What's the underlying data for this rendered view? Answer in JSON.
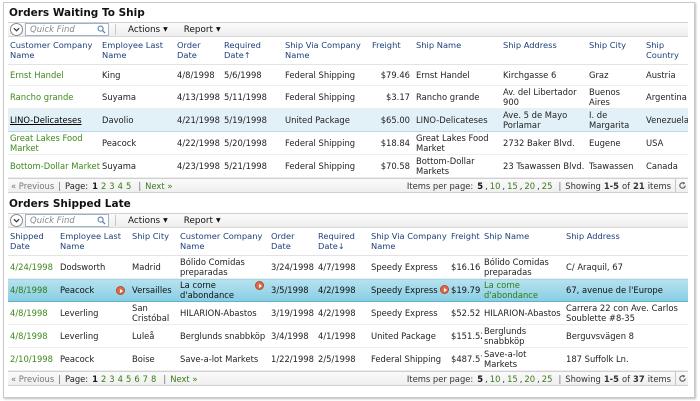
{
  "grid1": {
    "title": "Orders Waiting To Ship",
    "quick_find_placeholder": "Quick Find",
    "actions_label": "Actions",
    "report_label": "Report",
    "columns": [
      "Customer Company Name",
      "Employee Last Name",
      "Order Date",
      "Required Date",
      "Ship Via Company Name",
      "Freight",
      "Ship Name",
      "Ship Address",
      "Ship City",
      "Ship Country"
    ],
    "sort_arrow": "↑",
    "rows": [
      {
        "company": "Ernst Handel",
        "employee": "King",
        "order_date": "4/8/1998",
        "required_date": "5/6/1998",
        "ship_via": "Federal Shipping",
        "freight": "$79.46",
        "ship_name": "Ernst Handel",
        "address": "Kirchgasse 6",
        "city": "Graz",
        "country": "Austria"
      },
      {
        "company": "Rancho grande",
        "employee": "Suyama",
        "order_date": "4/13/1998",
        "required_date": "5/11/1998",
        "ship_via": "Federal Shipping",
        "freight": "$3.17",
        "ship_name": "Rancho grande",
        "address": "Av. del Libertador 900",
        "city": "Buenos Aires",
        "country": "Argentina"
      },
      {
        "company": "LINO-Delicateses",
        "employee": "Davolio",
        "order_date": "4/21/1998",
        "required_date": "5/19/1998",
        "ship_via": "United Package",
        "freight": "$65.00",
        "ship_name": "LINO-Delicateses",
        "address": "Ave. 5 de Mayo Porlamar",
        "city": "I. de Margarita",
        "country": "Venezuela"
      },
      {
        "company": "Great Lakes Food Market",
        "employee": "Peacock",
        "order_date": "4/22/1998",
        "required_date": "5/20/1998",
        "ship_via": "Federal Shipping",
        "freight": "$18.84",
        "ship_name": "Great Lakes Food Market",
        "address": "2732 Baker Blvd.",
        "city": "Eugene",
        "country": "USA"
      },
      {
        "company": "Bottom-Dollar Markets",
        "employee": "Suyama",
        "order_date": "4/23/1998",
        "required_date": "5/21/1998",
        "ship_via": "Federal Shipping",
        "freight": "$70.58",
        "ship_name": "Bottom-Dollar Markets",
        "address": "23 Tsawassen Blvd.",
        "city": "Tsawassen",
        "country": "Canada"
      }
    ],
    "pager": {
      "previous": "« Previous",
      "page_label": "Page:",
      "pages": [
        "1",
        "2",
        "3",
        "4",
        "5"
      ],
      "next": "Next »",
      "items_per_page_label": "Items per page:",
      "items_per_page": [
        "5",
        "10",
        "15",
        "20",
        "25"
      ],
      "showing_prefix": "Showing",
      "showing_range": "1-5",
      "of_label": "of",
      "total": "21",
      "items_label": "items"
    }
  },
  "grid2": {
    "title": "Orders Shipped Late",
    "quick_find_placeholder": "Quick Find",
    "actions_label": "Actions",
    "report_label": "Report",
    "columns": [
      "Shipped Date",
      "Employee Last Name",
      "Ship City",
      "Customer Company Name",
      "Order Date",
      "Required Date",
      "Ship Via Company Name",
      "Freight",
      "Ship Name",
      "Ship Address"
    ],
    "sort_arrow": "↓",
    "rows": [
      {
        "shipped_date": "4/24/1998",
        "employee": "Dodsworth",
        "city": "Madrid",
        "company": "Bólido Comidas preparadas",
        "order_date": "3/24/1998",
        "required_date": "4/7/1998",
        "ship_via": "Speedy Express",
        "freight": "$16.16",
        "ship_name": "Bólido Comidas preparadas",
        "address": "C/ Araquil, 67"
      },
      {
        "shipped_date": "4/8/1998",
        "employee": "Peacock",
        "city": "Versailles",
        "company": "La corne d'abondance",
        "order_date": "3/5/1998",
        "required_date": "4/2/1998",
        "ship_via": "Speedy Express",
        "freight": "$19.79",
        "ship_name": "La corne d'abondance",
        "address": "67, avenue de l'Europe"
      },
      {
        "shipped_date": "4/8/1998",
        "employee": "Leverling",
        "city": "San Cristóbal",
        "company": "HILARION-Abastos",
        "order_date": "3/19/1998",
        "required_date": "4/2/1998",
        "ship_via": "Speedy Express",
        "freight": "$52.52",
        "ship_name": "HILARION-Abastos",
        "address": "Carrera 22 con Ave. Carlos Soublette #8-35"
      },
      {
        "shipped_date": "4/8/1998",
        "employee": "Leverling",
        "city": "Luleå",
        "company": "Berglunds snabbköp",
        "order_date": "3/4/1998",
        "required_date": "4/1/1998",
        "ship_via": "United Package",
        "freight": "$151.52",
        "ship_name": "Berglunds snabbköp",
        "address": "Berguvsvägen 8"
      },
      {
        "shipped_date": "2/10/1998",
        "employee": "Peacock",
        "city": "Boise",
        "company": "Save-a-lot Markets",
        "order_date": "1/22/1998",
        "required_date": "2/5/1998",
        "ship_via": "Federal Shipping",
        "freight": "$487.57",
        "ship_name": "Save-a-lot Markets",
        "address": "187 Suffolk Ln."
      }
    ],
    "pager": {
      "previous": "« Previous",
      "page_label": "Page:",
      "pages": [
        "1",
        "2",
        "3",
        "4",
        "5",
        "6",
        "7",
        "8"
      ],
      "next": "Next »",
      "items_per_page_label": "Items per page:",
      "items_per_page": [
        "5",
        "10",
        "15",
        "20",
        "25"
      ],
      "showing_prefix": "Showing",
      "showing_range": "1-5",
      "of_label": "of",
      "total": "37",
      "items_label": "items"
    }
  }
}
